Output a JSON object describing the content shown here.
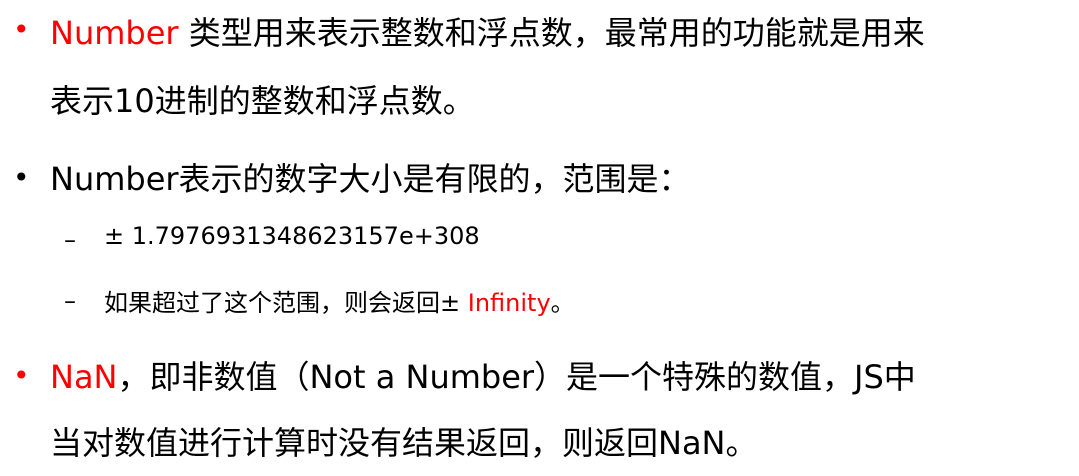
{
  "bullets": [
    {
      "marker": "•",
      "lines": [
        {
          "highlight": "Number",
          "rest": " 类型用来表示整数和浮点数，最常用的功能就是用来"
        },
        {
          "text": "表示10进制的整数和浮点数。"
        }
      ]
    },
    {
      "marker": "•",
      "lines": [
        {
          "text": "Number表示的数字大小是有限的，范围是："
        }
      ],
      "sub": [
        {
          "dash": "–",
          "text": "± 1.7976931348623157e+308"
        },
        {
          "dash": "–",
          "before": "如果超过了这个范围，则会返回± ",
          "highlight": "Infinity",
          "after": "。"
        }
      ]
    },
    {
      "marker": "•",
      "lines": [
        {
          "highlight": "NaN",
          "rest": "，即非数值（Not a Number）是一个特殊的数值，JS中"
        },
        {
          "text": "当对数值进行计算时没有结果返回，则返回NaN。"
        }
      ]
    }
  ],
  "colors": {
    "text": "#000000",
    "highlight": "#ff0000"
  }
}
